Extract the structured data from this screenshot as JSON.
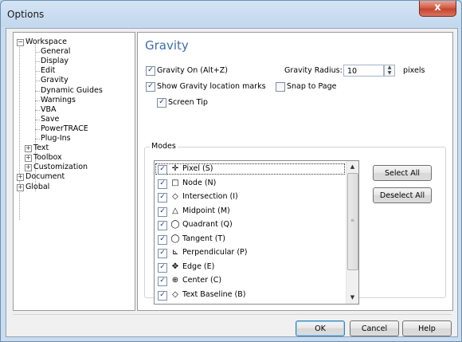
{
  "window": {
    "title": "Options",
    "close_label": "x"
  },
  "tree": {
    "items": [
      {
        "label": "Workspace",
        "expander": "−"
      },
      {
        "label": "General"
      },
      {
        "label": "Display"
      },
      {
        "label": "Edit"
      },
      {
        "label": "Gravity"
      },
      {
        "label": "Dynamic Guides"
      },
      {
        "label": "Warnings"
      },
      {
        "label": "VBA"
      },
      {
        "label": "Save"
      },
      {
        "label": "PowerTRACE"
      },
      {
        "label": "Plug-Ins"
      },
      {
        "label": "Text",
        "expander": "+"
      },
      {
        "label": "Toolbox",
        "expander": "+"
      },
      {
        "label": "Customization",
        "expander": "+"
      },
      {
        "label": "Document",
        "expander": "+"
      },
      {
        "label": "Global",
        "expander": "+"
      }
    ]
  },
  "panel": {
    "heading": "Gravity",
    "gravity_on": {
      "label": "Gravity On (Alt+Z)",
      "checked": true
    },
    "show_marks": {
      "label": "Show Gravity location marks",
      "checked": true
    },
    "screen_tip": {
      "label": "Screen Tip",
      "checked": true
    },
    "snap_to_page": {
      "label": "Snap to Page",
      "checked": false
    },
    "radius": {
      "label": "Gravity Radius:",
      "value": "10",
      "unit": "pixels"
    },
    "modes_label": "Modes",
    "modes": [
      {
        "icon": "pixel-icon",
        "glyph": "✛",
        "label": "Pixel (S)"
      },
      {
        "icon": "node-icon",
        "glyph": "□",
        "label": "Node (N)"
      },
      {
        "icon": "intersection-icon",
        "glyph": "◇",
        "label": "Intersection (I)"
      },
      {
        "icon": "midpoint-icon",
        "glyph": "△",
        "label": "Midpoint (M)"
      },
      {
        "icon": "quadrant-icon",
        "glyph": "◯",
        "label": "Quadrant (Q)"
      },
      {
        "icon": "tangent-icon",
        "glyph": "◯",
        "label": "Tangent (T)"
      },
      {
        "icon": "perpendicular-icon",
        "glyph": "⊾",
        "label": "Perpendicular (P)"
      },
      {
        "icon": "edge-icon",
        "glyph": "✥",
        "label": "Edge (E)"
      },
      {
        "icon": "center-icon",
        "glyph": "⊕",
        "label": "Center (C)"
      },
      {
        "icon": "text-baseline-icon",
        "glyph": "◇",
        "label": "Text Baseline (B)"
      }
    ],
    "select_all": "Select All",
    "deselect_all": "Deselect All"
  },
  "footer": {
    "ok": "OK",
    "cancel": "Cancel",
    "help": "Help"
  }
}
